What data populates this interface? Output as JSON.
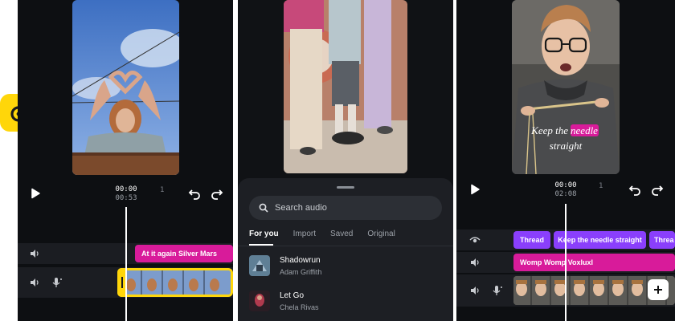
{
  "left_phone": {
    "time_current": "00:00",
    "time_total": "00:53",
    "marker": "1",
    "music_clip": "At it again  Silver Mars"
  },
  "middle_phone": {
    "search_placeholder": "Search audio",
    "tabs": [
      "For you",
      "Import",
      "Saved",
      "Original"
    ],
    "songs": [
      {
        "title": "Shadowrun",
        "artist": "Adam Griffith"
      },
      {
        "title": "Let Go",
        "artist": "Chela Rivas"
      }
    ]
  },
  "right_phone": {
    "caption_line1_a": "Keep the",
    "caption_line1_b": "needle",
    "caption_line2": "straight",
    "time_current": "00:00",
    "time_total": "02:08",
    "marker": "1",
    "text_clips": [
      "Thread",
      "Keep the needle straight",
      "Threa"
    ],
    "music_clip": "Womp Womp  Voxluxl"
  },
  "colors": {
    "brand_yellow": "#ffd60a",
    "music_pink": "#d81b9a",
    "text_purple": "#8a3ffc"
  },
  "icons": [
    "app-badge-icon",
    "play-icon",
    "undo-icon",
    "redo-icon",
    "volume-icon",
    "mic-icon",
    "eye-icon",
    "search-icon",
    "plus-icon"
  ]
}
